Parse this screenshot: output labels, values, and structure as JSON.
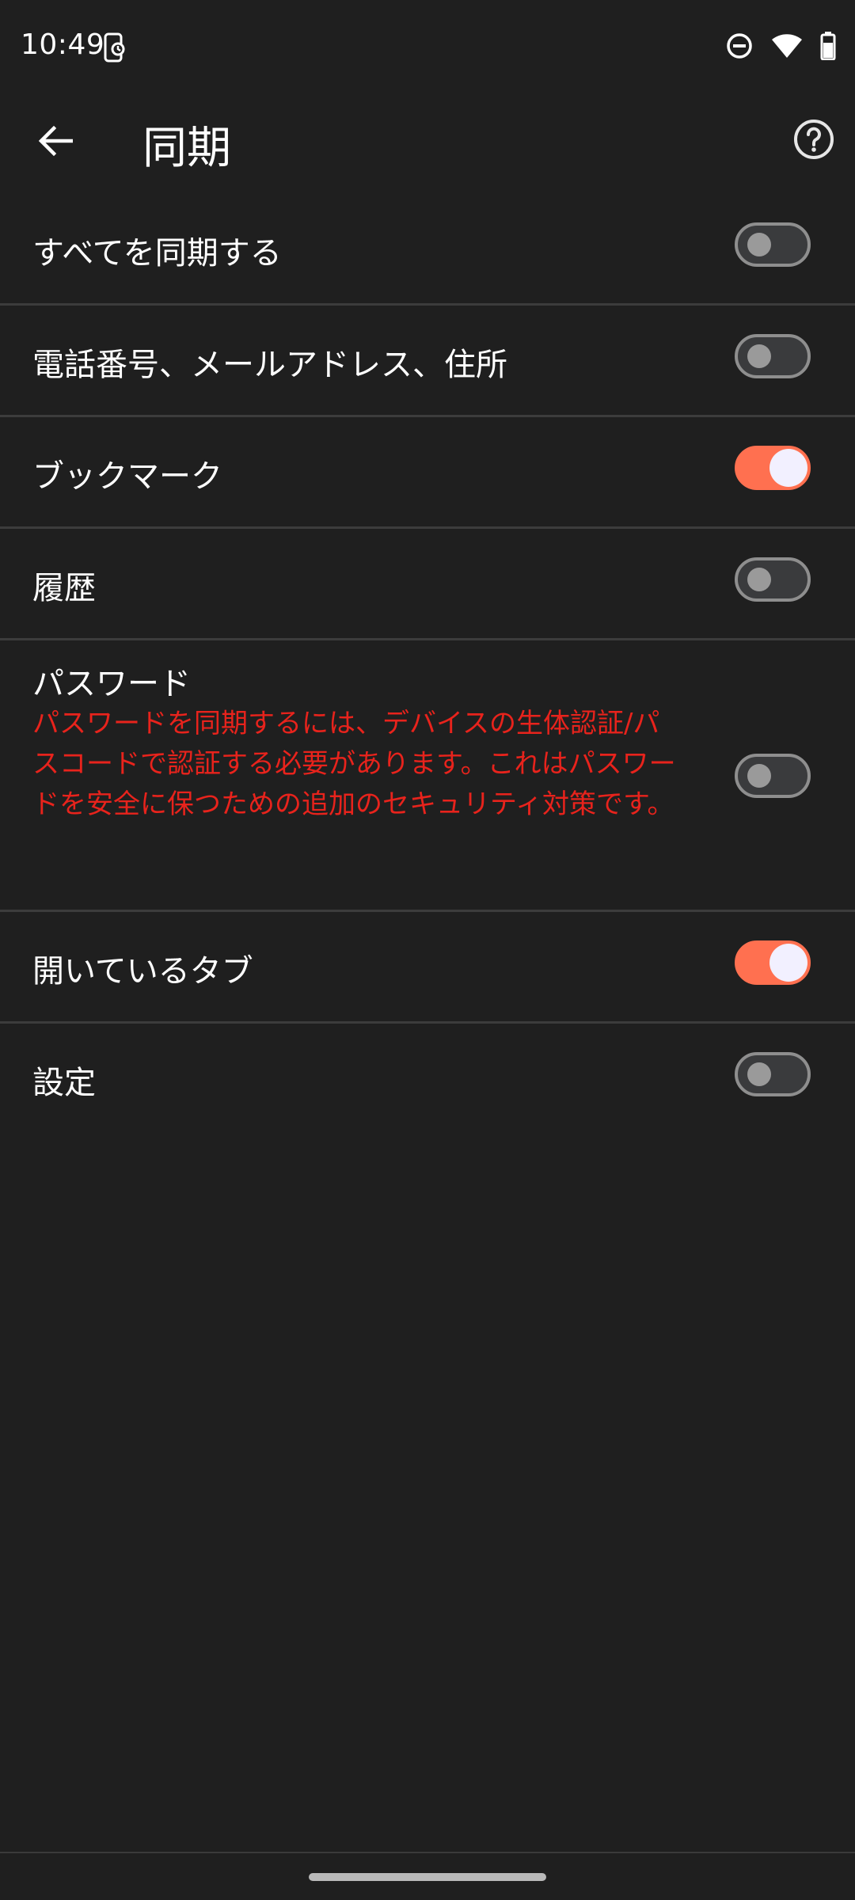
{
  "status_bar": {
    "time": "10:49",
    "icons": [
      "screenshot-phone-icon",
      "do-not-disturb-icon",
      "wifi-icon",
      "battery-icon"
    ]
  },
  "app_bar": {
    "title": "同期",
    "back_icon": "arrow-left-icon",
    "help_icon": "help-circle-icon"
  },
  "settings": [
    {
      "label": "すべてを同期する",
      "toggle": "off"
    },
    {
      "label": "電話番号、メールアドレス、住所",
      "toggle": "off"
    },
    {
      "label": "ブックマーク",
      "toggle": "on"
    },
    {
      "label": "履歴",
      "toggle": "off"
    },
    {
      "label": "パスワード",
      "toggle": "off",
      "warning": "パスワードを同期するには、デバイスの生体認証/パスコードで認証する必要があります。これはパスワードを安全に保つための追加のセキュリティ対策です。"
    },
    {
      "label": "開いているタブ",
      "toggle": "on"
    },
    {
      "label": "設定",
      "toggle": "off"
    }
  ],
  "colors": {
    "background": "#1f1f1f",
    "accent_on": "#ff7050",
    "warning_text": "#e8231c",
    "divider": "#3c3c3c"
  }
}
